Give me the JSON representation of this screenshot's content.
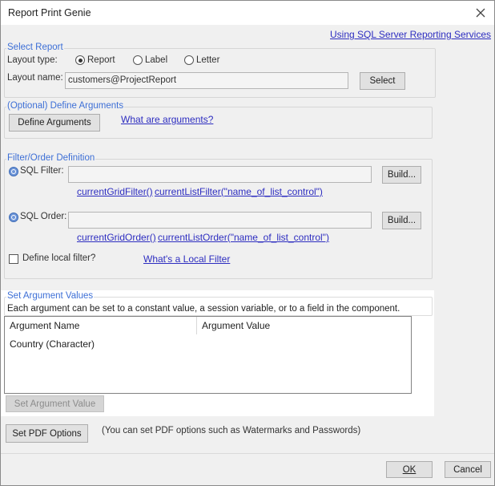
{
  "window": {
    "title": "Report Print Genie"
  },
  "header_link": "Using SQL Server Reporting Services",
  "select_report": {
    "legend": "Select Report",
    "layout_type_label": "Layout type:",
    "layout_options": [
      "Report",
      "Label",
      "Letter"
    ],
    "selected_layout": "Report",
    "layout_name_label": "Layout name:",
    "layout_name_value": "customers@ProjectReport",
    "select_button": "Select"
  },
  "arguments": {
    "legend": "(Optional) Define Arguments",
    "define_button": "Define Arguments",
    "help_link": "What are arguments?"
  },
  "filter_order": {
    "legend": "Filter/Order Definition",
    "sql_filter_label": "SQL Filter:",
    "sql_filter_value": "",
    "build_button": "Build...",
    "filter_links": [
      "currentGridFilter()",
      "currentListFilter(\"name_of_list_control\")"
    ],
    "sql_order_label": "SQL Order:",
    "sql_order_value": "",
    "order_links": [
      "currentGridOrder()",
      "currentListOrder(\"name_of_list_control\")"
    ],
    "local_filter_label": "Define local filter?",
    "local_filter_checked": false,
    "local_filter_link": "What's a Local Filter"
  },
  "argument_values": {
    "legend": "Set Argument Values",
    "description": "Each argument can be set to a constant value, a session variable, or to a field in the component.",
    "columns": [
      "Argument Name",
      "Argument Value"
    ],
    "rows": [
      {
        "name": "Country (Character)",
        "value": ""
      }
    ],
    "set_button": "Set Argument Value"
  },
  "pdf": {
    "button": "Set PDF Options",
    "note": "(You can set PDF options such as Watermarks and Passwords)"
  },
  "footer": {
    "ok": "OK",
    "cancel": "Cancel"
  }
}
